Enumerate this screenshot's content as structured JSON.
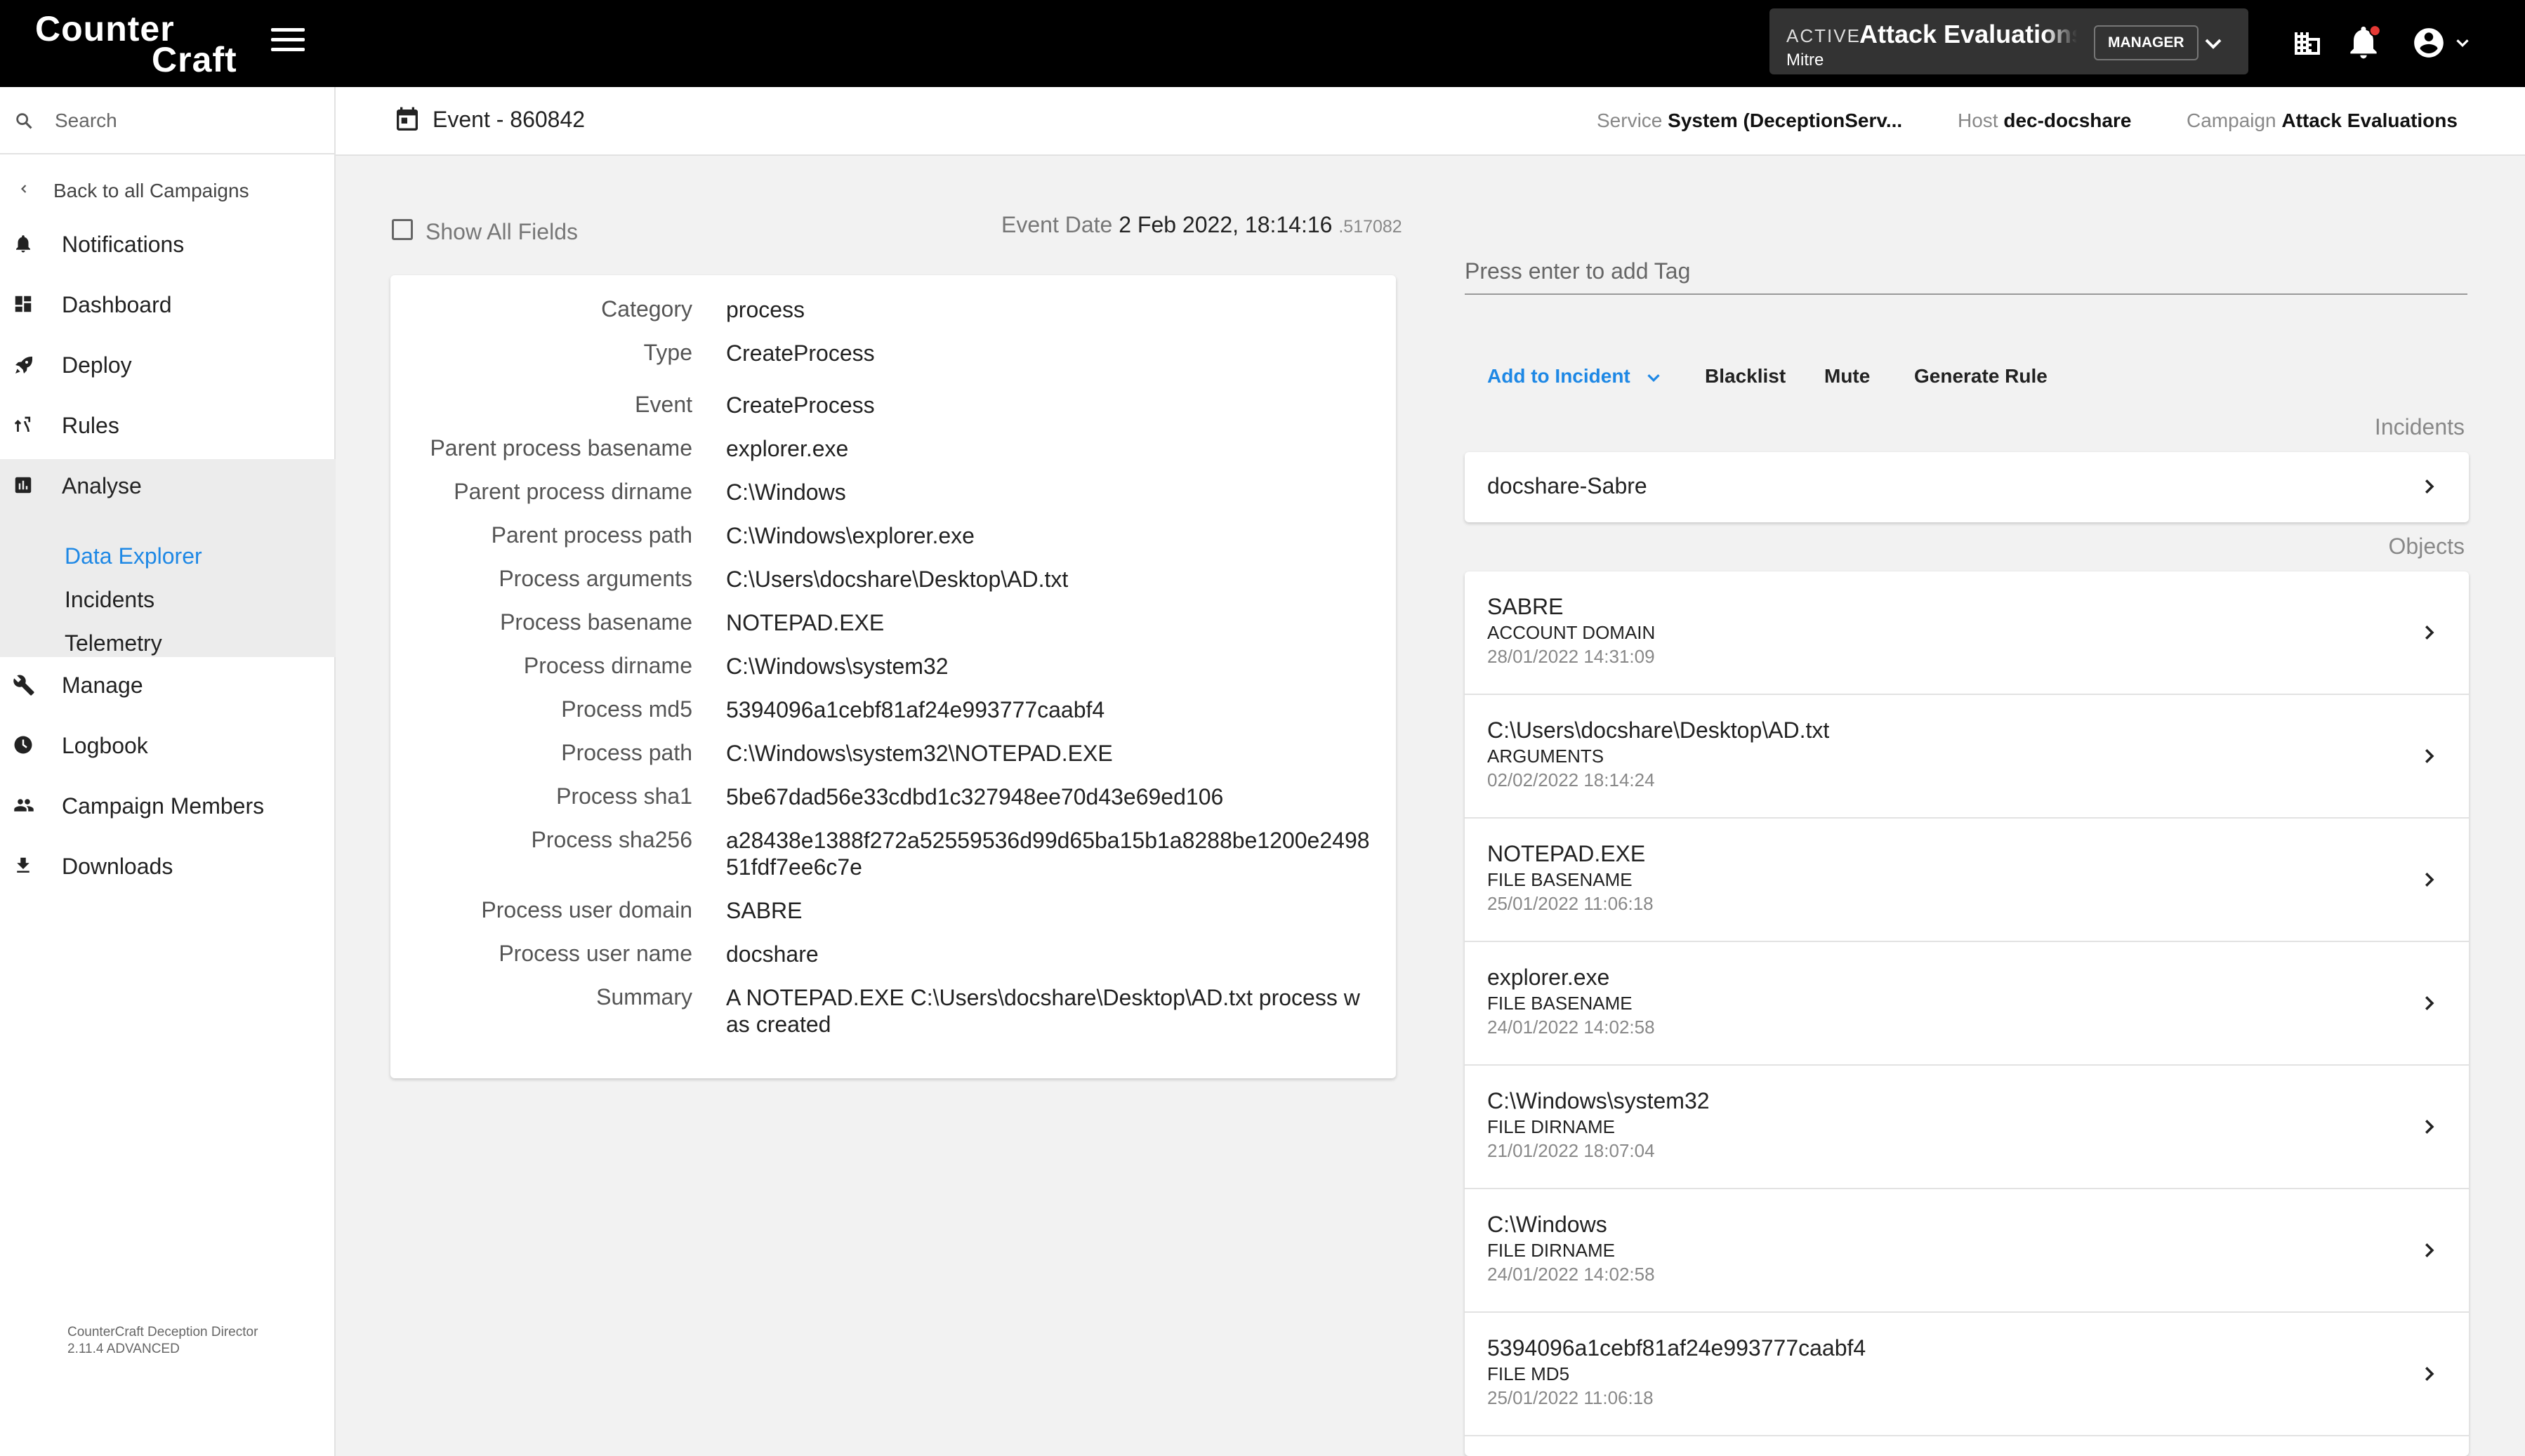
{
  "app": {
    "logo_line1": "Counter",
    "logo_line2": "Craft"
  },
  "topbar": {
    "status": "ACTIVE",
    "campaign_name": "Attack Evaluations",
    "organization": "Mitre",
    "role": "MANAGER"
  },
  "sidebar": {
    "search_placeholder": "Search",
    "back_label": "Back to all Campaigns",
    "items": [
      {
        "label": "Notifications",
        "icon": "bell-icon"
      },
      {
        "label": "Dashboard",
        "icon": "dashboard-icon"
      },
      {
        "label": "Deploy",
        "icon": "rocket-icon"
      },
      {
        "label": "Rules",
        "icon": "rules-icon"
      },
      {
        "label": "Analyse",
        "icon": "chart-icon"
      },
      {
        "label": "Manage",
        "icon": "wrench-icon"
      },
      {
        "label": "Logbook",
        "icon": "clock-icon"
      },
      {
        "label": "Campaign Members",
        "icon": "people-icon"
      },
      {
        "label": "Downloads",
        "icon": "download-icon"
      }
    ],
    "analyse_sub": [
      "Data Explorer",
      "Incidents",
      "Telemetry"
    ],
    "version_line1": "CounterCraft Deception Director",
    "version_line2": "2.11.4 ADVANCED"
  },
  "header": {
    "title": "Event - 860842",
    "service_label": "Service",
    "service_value": "System (DeceptionServ...",
    "host_label": "Host",
    "host_value": "dec-docshare",
    "campaign_label": "Campaign",
    "campaign_value": "Attack Evaluations"
  },
  "details": {
    "show_all_label": "Show All Fields",
    "event_date_label": "Event Date",
    "event_date_value": "2 Feb 2022, 18:14:16",
    "event_date_ms": ".517082",
    "fields": [
      {
        "key": "Category",
        "value": "process"
      },
      {
        "key": "Type",
        "value": "CreateProcess"
      },
      {
        "key": "Event",
        "value": "CreateProcess"
      },
      {
        "key": "Parent process basename",
        "value": "explorer.exe"
      },
      {
        "key": "Parent process dirname",
        "value": "C:\\Windows"
      },
      {
        "key": "Parent process path",
        "value": "C:\\Windows\\explorer.exe"
      },
      {
        "key": "Process arguments",
        "value": "C:\\Users\\docshare\\Desktop\\AD.txt"
      },
      {
        "key": "Process basename",
        "value": "NOTEPAD.EXE"
      },
      {
        "key": "Process dirname",
        "value": "C:\\Windows\\system32"
      },
      {
        "key": "Process md5",
        "value": "5394096a1cebf81af24e993777caabf4"
      },
      {
        "key": "Process path",
        "value": "C:\\Windows\\system32\\NOTEPAD.EXE"
      },
      {
        "key": "Process sha1",
        "value": "5be67dad56e33cdbd1c327948ee70d43e69ed106"
      },
      {
        "key": "Process sha256",
        "value": "a28438e1388f272a52559536d99d65ba15b1a8288be1200e249851fdf7ee6c7e"
      },
      {
        "key": "Process user domain",
        "value": "SABRE"
      },
      {
        "key": "Process user name",
        "value": "docshare"
      },
      {
        "key": "Summary",
        "value": "A NOTEPAD.EXE C:\\Users\\docshare\\Desktop\\AD.txt process was created"
      }
    ]
  },
  "right": {
    "tag_placeholder": "Press enter to add Tag",
    "actions": {
      "add_to_incident": "Add to Incident",
      "blacklist": "Blacklist",
      "mute": "Mute",
      "generate_rule": "Generate Rule"
    },
    "incidents_label": "Incidents",
    "incidents": [
      "docshare-Sabre"
    ],
    "objects_label": "Objects",
    "objects": [
      {
        "name": "SABRE",
        "type": "ACCOUNT DOMAIN",
        "date": "28/01/2022 14:31:09"
      },
      {
        "name": "C:\\Users\\docshare\\Desktop\\AD.txt",
        "type": "ARGUMENTS",
        "date": "02/02/2022 18:14:24"
      },
      {
        "name": "NOTEPAD.EXE",
        "type": "FILE BASENAME",
        "date": "25/01/2022 11:06:18"
      },
      {
        "name": "explorer.exe",
        "type": "FILE BASENAME",
        "date": "24/01/2022 14:02:58"
      },
      {
        "name": "C:\\Windows\\system32",
        "type": "FILE DIRNAME",
        "date": "21/01/2022 18:07:04"
      },
      {
        "name": "C:\\Windows",
        "type": "FILE DIRNAME",
        "date": "24/01/2022 14:02:58"
      },
      {
        "name": "5394096a1cebf81af24e993777caabf4",
        "type": "FILE MD5",
        "date": "25/01/2022 11:06:18"
      }
    ]
  },
  "colors": {
    "accent": "#1e88e5",
    "topbar": "#000000",
    "notification_dot": "#e53935"
  }
}
